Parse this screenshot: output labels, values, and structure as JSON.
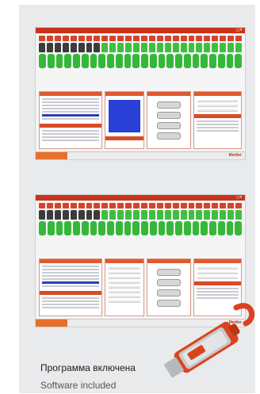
{
  "screenshots": [
    {
      "title": "Software window",
      "brand": "Mettler"
    },
    {
      "title": "Software window",
      "brand": "Mettler"
    }
  ],
  "caption": {
    "ru": "Программа включена",
    "en": "Software included"
  },
  "colors": {
    "accent_red": "#c8331b",
    "tube_green": "#35b83a",
    "chart_blue": "#2a3fd6"
  },
  "usb_icon": "usb-drive-icon"
}
